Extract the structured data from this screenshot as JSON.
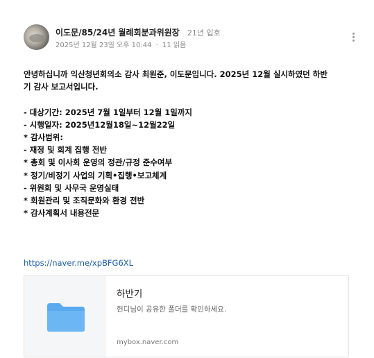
{
  "author": {
    "name": "이도문/85/24년 월례회분과위원장",
    "rank": "21년 입호"
  },
  "meta": {
    "date": "2025년 12월 23일 오후 10:44",
    "separator": "·",
    "views": "11 읽음"
  },
  "body": {
    "lines": [
      "안녕하십니까 익산청년회의소 감사 최원준, 이도문입니다. 2025년 12월 실시하였던 하반",
      "기 감사 보고서입니다.",
      "",
      "- 대상기간: 2025년 7월 1일부터 12월 1일까지",
      "- 시행일자: 2025년12월18일~12월22일",
      "* 감사범위:",
      "- 재정 및 회계 집행 전반",
      "* 총회 및 이사회 운영의 정관/규정 준수여부",
      "* 정기/비정기 사업의 기획•집행•보고체계",
      "- 위원회 및 사무국 운영실태",
      "* 회원관리 및 조직문화와 환경 전반",
      "* 감사계획서 내용전문"
    ]
  },
  "link": {
    "url": "https://naver.me/xpBFG6XL"
  },
  "og_card": {
    "title": "하반기",
    "description": "헌디님이 공유한 폴더를 확인하세요.",
    "domain": "mybox.naver.com",
    "icon": "folder-icon"
  },
  "colors": {
    "link": "#1a5cb0",
    "folder": "#5aaaf0"
  }
}
